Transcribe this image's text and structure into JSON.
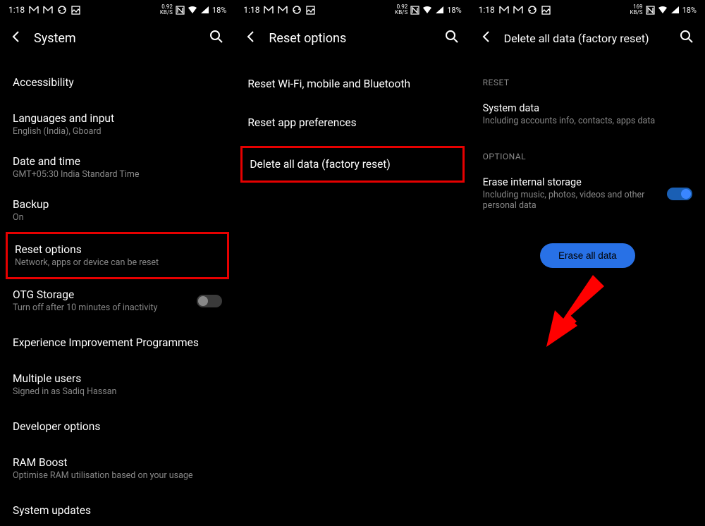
{
  "status": {
    "time": "1:18",
    "data_rate_a": "0.92",
    "data_rate_b": "169",
    "data_unit": "KB/S",
    "battery": "18%"
  },
  "screen1": {
    "title": "System",
    "items": [
      {
        "title": "Accessibility",
        "subtitle": ""
      },
      {
        "title": "Languages and input",
        "subtitle": "English (India), Gboard"
      },
      {
        "title": "Date and time",
        "subtitle": "GMT+05:30 India Standard Time"
      },
      {
        "title": "Backup",
        "subtitle": "On"
      },
      {
        "title": "Reset options",
        "subtitle": "Network, apps or device can be reset"
      },
      {
        "title": "OTG Storage",
        "subtitle": "Turn off after 10 minutes of inactivity"
      },
      {
        "title": "Experience Improvement Programmes",
        "subtitle": ""
      },
      {
        "title": "Multiple users",
        "subtitle": "Signed in as Sadiq Hassan"
      },
      {
        "title": "Developer options",
        "subtitle": ""
      },
      {
        "title": "RAM Boost",
        "subtitle": "Optimise RAM utilisation based on your usage"
      },
      {
        "title": "System updates",
        "subtitle": ""
      }
    ]
  },
  "screen2": {
    "title": "Reset options",
    "items": [
      {
        "title": "Reset Wi-Fi, mobile and Bluetooth"
      },
      {
        "title": "Reset app preferences"
      },
      {
        "title": "Delete all data (factory reset)"
      }
    ]
  },
  "screen3": {
    "title": "Delete all data (factory reset)",
    "section1": "RESET",
    "system_data": {
      "title": "System data",
      "subtitle": "Including accounts info, contacts, apps data"
    },
    "section2": "OPTIONAL",
    "erase_storage": {
      "title": "Erase internal storage",
      "subtitle": "Including music, photos, videos and other personal data"
    },
    "erase_button": "Erase all data"
  }
}
